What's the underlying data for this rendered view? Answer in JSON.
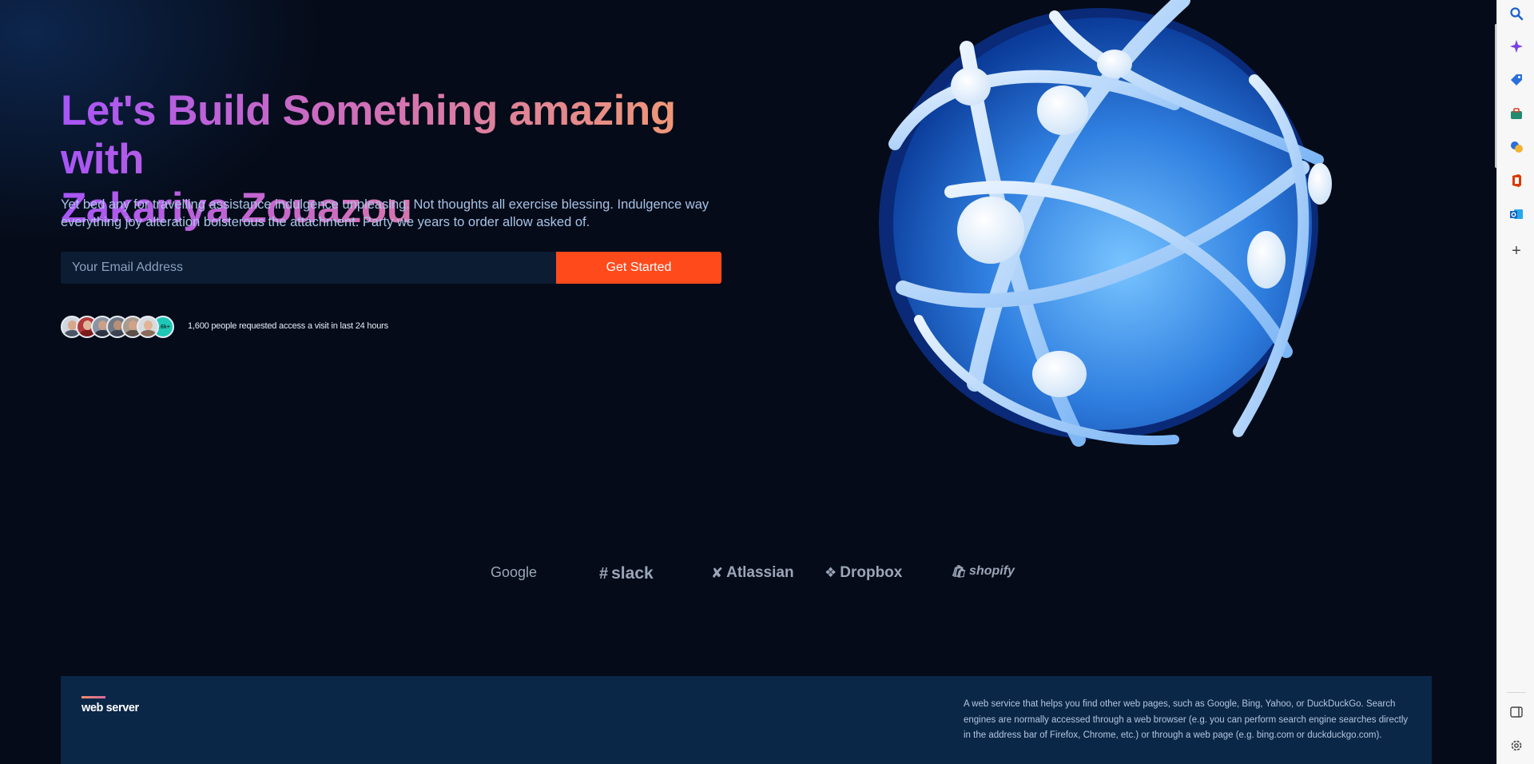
{
  "hero": {
    "title_line1": "Let's Build Something amazing with",
    "title_line2": "Zakariya Zouazou",
    "description": "Yet bed any for travelling assistance indulgence unpleasing. Not thoughts all exercise blessing. Indulgence way everything joy alteration boisterous the attachment. Party we years to order allow asked of."
  },
  "signup": {
    "email_placeholder": "Your Email Address",
    "email_value": "",
    "button_label": "Get Started"
  },
  "social_proof": {
    "avatar_count_badge": "1.6k+",
    "text": "1,600 people requested access a visit in last 24 hours"
  },
  "logos": {
    "google": "Google",
    "slack": "slack",
    "atlassian": "Atlassian",
    "dropbox": "Dropbox",
    "shopify": "shopify"
  },
  "footer": {
    "brand": "web server",
    "description": "A web service that helps you find other web pages, such as Google, Bing, Yahoo, or DuckDuckGo. Search engines are normally accessed through a web browser (e.g. you can perform search engine searches directly in the address bar of Firefox, Chrome, etc.) or through a web page (e.g. bing.com or duckduckgo.com)."
  },
  "colors": {
    "background": "#050b18",
    "accent_button": "#ff4a1c",
    "gradient_start": "#a855f7",
    "gradient_end": "#f59e6b",
    "footer_bg": "#0b2748"
  },
  "edge_sidebar": {
    "icons": [
      "search-icon",
      "copilot-icon",
      "shopping-tag-icon",
      "tools-briefcase-icon",
      "games-icon",
      "office-icon",
      "outlook-icon",
      "add-icon",
      "hide-sidebar-icon",
      "settings-icon"
    ]
  }
}
